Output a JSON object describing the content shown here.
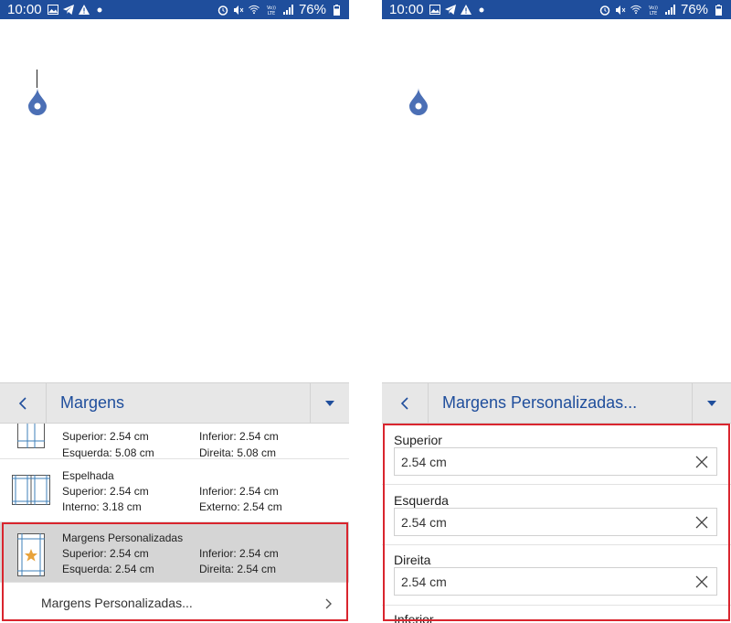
{
  "status": {
    "time": "10:00",
    "battery": "76%",
    "left_icons": [
      "image-icon",
      "telegram-icon",
      "warning-icon",
      "dot-icon"
    ],
    "right_icons": [
      "alarm-icon",
      "mute-icon",
      "wifi-icon",
      "volte-icon",
      "signal-icon",
      "battery-icon"
    ],
    "volte_label": "VoLTE"
  },
  "left": {
    "toolbar_title": "Margens",
    "items": [
      {
        "name": "",
        "row1_left": "Superior: 2.54 cm",
        "row1_right": "Inferior: 2.54 cm",
        "row2_left": "Esquerda: 5.08 cm",
        "row2_right": "Direita: 5.08 cm"
      },
      {
        "name": "Espelhada",
        "row1_left": "Superior: 2.54 cm",
        "row1_right": "Inferior: 2.54 cm",
        "row2_left": "Interno: 3.18 cm",
        "row2_right": "Externo: 2.54 cm"
      },
      {
        "name": "Margens Personalizadas",
        "row1_left": "Superior: 2.54 cm",
        "row1_right": "Inferior: 2.54 cm",
        "row2_left": "Esquerda: 2.54 cm",
        "row2_right": "Direita: 2.54 cm"
      }
    ],
    "custom_link": "Margens Personalizadas..."
  },
  "right": {
    "toolbar_title": "Margens Personalizadas...",
    "fields": [
      {
        "label": "Superior",
        "value": "2.54 cm"
      },
      {
        "label": "Esquerda",
        "value": "2.54 cm"
      },
      {
        "label": "Direita",
        "value": "2.54 cm"
      },
      {
        "label": "Inferior",
        "value": ""
      }
    ]
  },
  "colors": {
    "accent": "#1f4e9c",
    "statusbar": "#1f4e9c",
    "highlight_border": "#d9252e",
    "selected_row": "#d5d5d5",
    "star": "#e8a33c"
  }
}
